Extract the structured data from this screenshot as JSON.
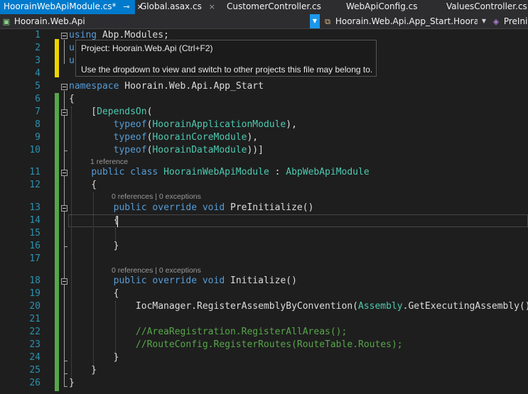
{
  "tabs": [
    {
      "label": "HoorainWebApiModule.cs*",
      "pin": "⊸",
      "close": "×",
      "active": true
    },
    {
      "label": "Global.asax.cs",
      "close": "×"
    },
    {
      "label": "CustomerController.cs"
    },
    {
      "label": "WebApiConfig.cs"
    },
    {
      "label": "ValuesController.cs"
    }
  ],
  "navbar": {
    "project": "Hoorain.Web.Api",
    "type_scope": "Hoorain.Web.Api.App_Start.HoorainW",
    "member_scope": "PreInit",
    "icons": {
      "project": "csharp-project-icon",
      "type": "class-icon",
      "member": "method-icon"
    }
  },
  "tooltip": {
    "title": "Project: Hoorain.Web.Api (Ctrl+F2)",
    "body": "Use the dropdown to view and switch to other projects this file may belong to."
  },
  "line_numbers": [
    "1",
    "2",
    "3",
    "4",
    "5",
    "6",
    "7",
    "8",
    "9",
    "10",
    "11",
    "12",
    "13",
    "14",
    "15",
    "16",
    "17",
    "18",
    "19",
    "20",
    "21",
    "22",
    "23",
    "24",
    "25",
    "26"
  ],
  "code_lines": [
    [
      "using",
      " Abp.Modules;"
    ],
    [
      "u"
    ],
    [
      "u"
    ],
    [
      ""
    ],
    [
      "namespace",
      " Hoorain.Web.Api.App_Start"
    ],
    [
      "{"
    ],
    [
      "    [",
      "DependsOn",
      "("
    ],
    [
      "        ",
      "typeof",
      "(",
      "HoorainApplicationModule",
      "),"
    ],
    [
      "        ",
      "typeof",
      "(",
      "HoorainCoreModule",
      "),"
    ],
    [
      "        ",
      "typeof",
      "(",
      "HoorainDataModule",
      "))]"
    ],
    [
      "    ",
      "public class",
      " ",
      "HoorainWebApiModule",
      " : ",
      "AbpWebApiModule"
    ],
    [
      "    {"
    ],
    [
      "        ",
      "public override void",
      " PreInitialize()"
    ],
    [
      "        {"
    ],
    [
      ""
    ],
    [
      "        }"
    ],
    [
      ""
    ],
    [
      "        ",
      "public override void",
      " Initialize()"
    ],
    [
      "        {"
    ],
    [
      "            IocManager.RegisterAssemblyByConvention(",
      "Assembly",
      ".GetExecutingAssembly());"
    ],
    [
      ""
    ],
    [
      "            ",
      "//AreaRegistration.RegisterAllAreas();"
    ],
    [
      "            ",
      "//RouteConfig.RegisterRoutes(RouteTable.Routes);"
    ],
    [
      "        }"
    ],
    [
      "    }"
    ],
    [
      "}"
    ]
  ],
  "codelens": {
    "class_refs": "1 reference",
    "preinit": "0 references | 0 exceptions",
    "init": "0 references | 0 exceptions"
  },
  "colors": {
    "keyword": "#569cd6",
    "type": "#4ec9b0",
    "comment": "#57a64a",
    "line_number": "#2b91af",
    "tab_active": "#007acc",
    "change_saved": "#57a64a",
    "change_unsaved": "#efd400"
  }
}
